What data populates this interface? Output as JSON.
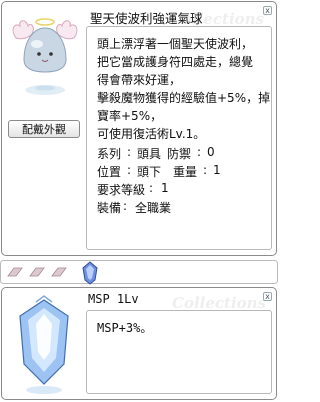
{
  "item": {
    "title": "聖天使波利強運氣球",
    "watermark": "Collections",
    "close_glyph": "x",
    "button_label": "配戴外觀",
    "description": [
      "頭上漂浮著一個聖天使波利，",
      "把它當成護身符四處走，總覺",
      "得會帶來好運，",
      "擊殺魔物獲得的經驗值+5%，掉",
      "寶率+5%，",
      "可使用復活術Lv.1。"
    ],
    "stats": [
      {
        "label": "系列",
        "value": "頭具",
        "label2": "防禦",
        "value2": "0"
      },
      {
        "label": "位置",
        "value": "頭下",
        "label2": "重量",
        "value2": "1"
      }
    ],
    "req_level": {
      "label": "要求等級",
      "value": "1"
    },
    "equip": {
      "label": "裝備",
      "value": "全職業"
    }
  },
  "slots": {
    "empty_count": 3,
    "filled_count": 1
  },
  "card": {
    "title": "MSP 1Lv",
    "watermark": "Collections",
    "close_glyph": "x",
    "description": "MSP+3%。"
  }
}
